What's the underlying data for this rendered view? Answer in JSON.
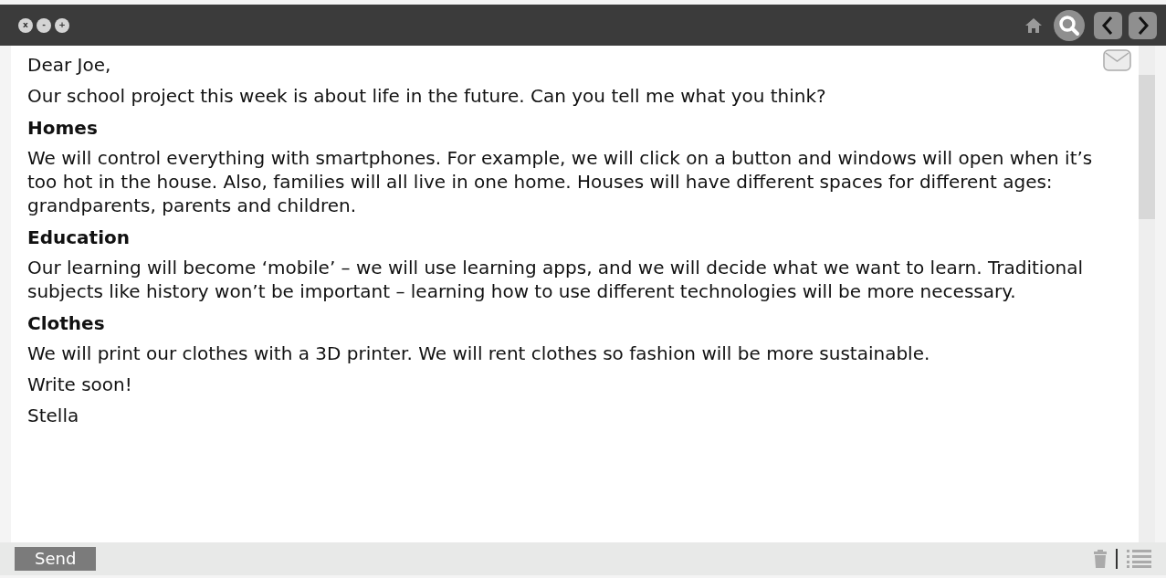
{
  "window": {
    "controls": [
      "x",
      "-",
      "+"
    ]
  },
  "letter": [
    {
      "kind": "text",
      "text": "Dear Joe,"
    },
    {
      "kind": "text",
      "text": "Our school project this week is about life in the future. Can you tell me what you think?"
    },
    {
      "kind": "heading",
      "text": "Homes"
    },
    {
      "kind": "text",
      "text": "We will control everything with smartphones. For example, we will click on a button and windows will open when it’s too hot in the house. Also, families will all live in one home. Houses will have different spaces for different ages: grandparents, parents and children."
    },
    {
      "kind": "heading",
      "text": "Education"
    },
    {
      "kind": "text",
      "text": "Our learning will become ‘mobile’ – we will use learning apps, and we will decide what we want to learn. Traditional subjects like history won’t be important – learning how to use different technologies will be more necessary."
    },
    {
      "kind": "heading",
      "text": "Clothes"
    },
    {
      "kind": "text",
      "text": "We will print our clothes with a 3D printer. We will rent clothes so fashion will be more sustainable."
    },
    {
      "kind": "text",
      "text": "Write soon!"
    },
    {
      "kind": "text",
      "text": "Stella"
    }
  ],
  "send_button": "Send"
}
